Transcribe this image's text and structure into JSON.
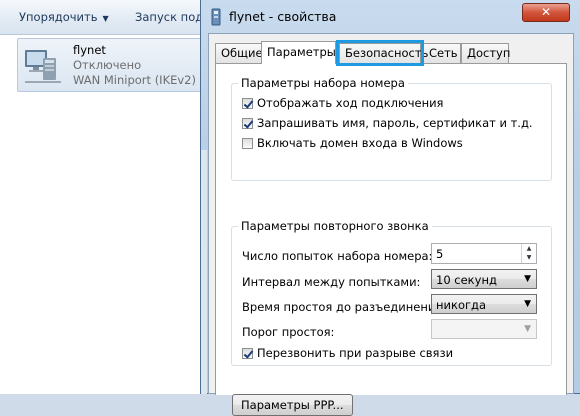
{
  "explorer": {
    "toolbar": {
      "organize": "Упорядочить",
      "launch": "Запуск подк"
    },
    "connection": {
      "name": "flynet",
      "status": "Отключено",
      "device": "WAN Miniport (IKEv2)"
    }
  },
  "dialog": {
    "title": "flynet - свойства",
    "close_label": "✕",
    "tabs": [
      "Общие",
      "Параметры",
      "Безопасность",
      "Сеть",
      "Доступ"
    ],
    "dial_group": {
      "legend": "Параметры набора номера",
      "options": [
        {
          "label": "Отображать ход подключения",
          "checked": true
        },
        {
          "label": "Запрашивать имя, пароль, сертификат и т.д.",
          "checked": true
        },
        {
          "label": "Включать домен входа в Windows",
          "checked": false
        }
      ]
    },
    "redial_group": {
      "legend": "Параметры повторного звонка",
      "attempts_label": "Число попыток набора номера:",
      "attempts_value": "5",
      "interval_label": "Интервал между попытками:",
      "interval_value": "10 секунд",
      "idle_label": "Время простоя до разъединения:",
      "idle_value": "никогда",
      "threshold_label": "Порог простоя:",
      "threshold_value": "",
      "redial_label": "Перезвонить при разрыве связи",
      "redial_checked": true
    },
    "ppp_button": "Параметры PPP..."
  },
  "colors": {
    "highlight": "#1e9ae0",
    "title_bar": "#b9cfe6",
    "close": "#c2391c"
  },
  "icons": {
    "window": "window-icon",
    "network": "network-connection-icon",
    "spin": "spin-arrows-icon",
    "dropdown": "dropdown-arrow-icon"
  }
}
